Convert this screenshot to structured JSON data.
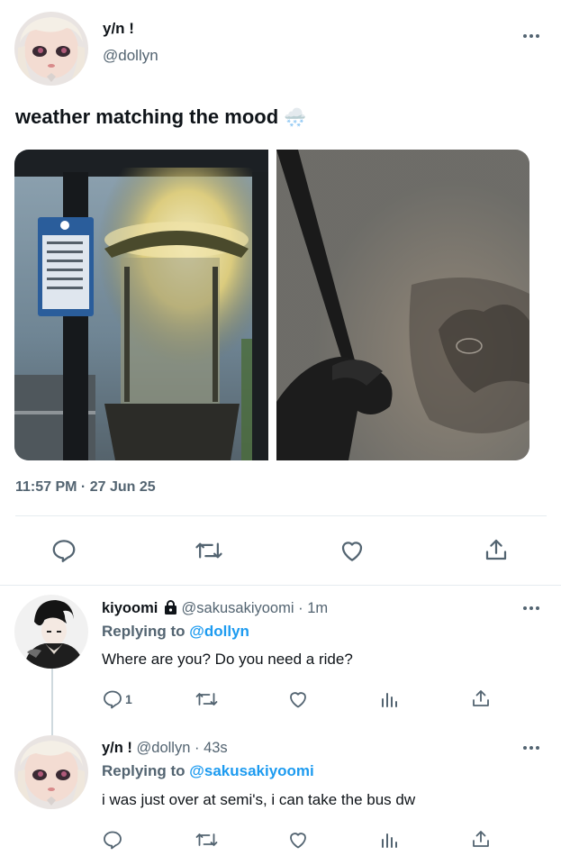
{
  "main_tweet": {
    "display_name": "y/n !",
    "handle": "@dollyn",
    "text": "weather matching the mood",
    "emoji": "🌨️",
    "timestamp": "11:57 PM · 27 Jun 25"
  },
  "replies": [
    {
      "display_name": "kiyoomi",
      "handle": "@sakusakiyoomi",
      "separator": "·",
      "time": "1m",
      "replying_label": "Replying to",
      "replying_to": "@dollyn",
      "text": "Where are you? Do you need a ride?",
      "reply_count": "1"
    },
    {
      "display_name": "y/n !",
      "handle": "@dollyn",
      "separator": "·",
      "time": "43s",
      "replying_label": "Replying to",
      "replying_to": "@sakusakiyoomi",
      "text": "i was just over at semi's, i can take the bus dw",
      "reply_count": ""
    }
  ],
  "icons": [
    "more-icon",
    "reply-icon",
    "retweet-icon",
    "like-icon",
    "share-icon",
    "analytics-icon",
    "lock-icon"
  ],
  "colors": {
    "accent": "#1d9bf0",
    "muted": "#536471",
    "text": "#0f1419",
    "divider": "#e6ecf0"
  }
}
